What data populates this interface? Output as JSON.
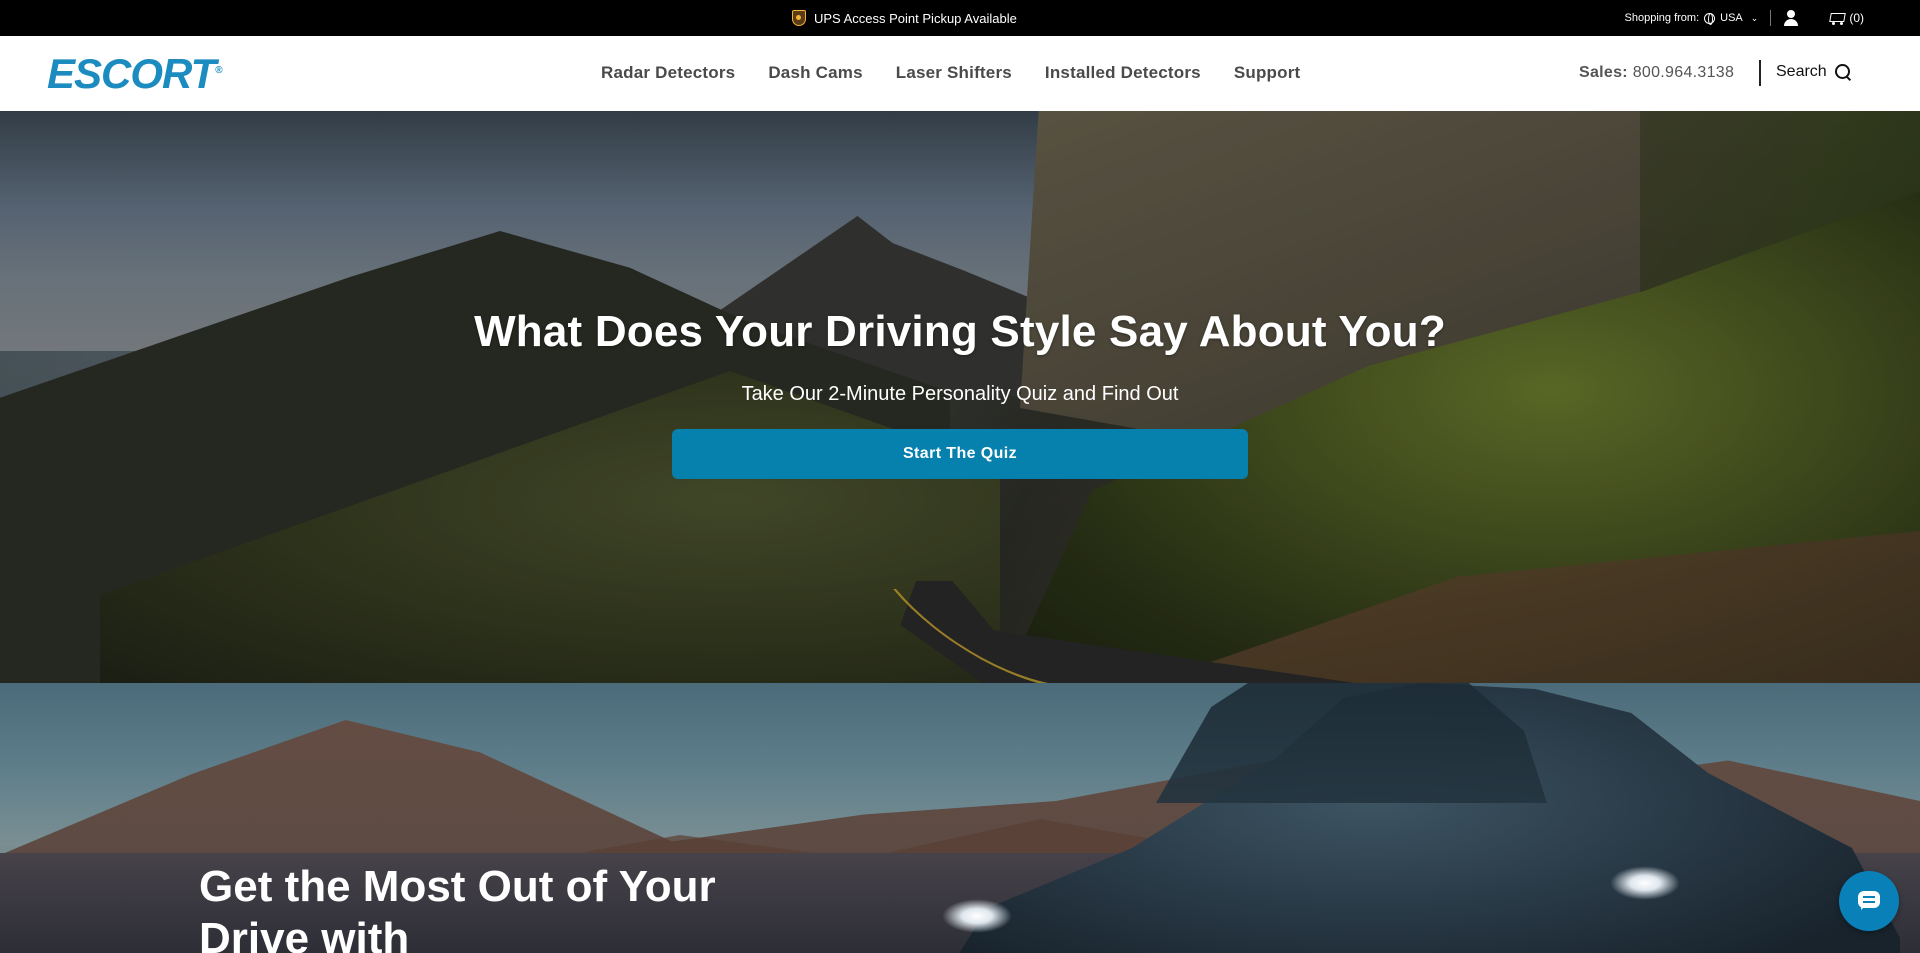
{
  "topbar": {
    "ups_text": "UPS Access Point Pickup Available",
    "shopping_from_label": "Shopping from:",
    "country": "USA",
    "cart_count": "(0)"
  },
  "header": {
    "logo_text": "ESCORT",
    "logo_mark": "®",
    "nav": [
      {
        "label": "Radar Detectors"
      },
      {
        "label": "Dash Cams"
      },
      {
        "label": "Laser Shifters"
      },
      {
        "label": "Installed Detectors"
      },
      {
        "label": "Support"
      }
    ],
    "sales_label": "Sales:",
    "sales_phone": "800.964.3138",
    "search_label": "Search"
  },
  "hero1": {
    "title": "What Does Your Driving Style Say About You?",
    "subtitle": "Take Our 2-Minute Personality Quiz and Find Out",
    "cta_label": "Start The Quiz"
  },
  "hero2": {
    "title": "Get the Most Out of Your Drive with"
  },
  "colors": {
    "brand_blue": "#1c8cc0",
    "cta_blue": "#0681ae",
    "topbar_bg": "#000000",
    "header_bg": "#ffffff"
  },
  "icons": [
    "ups-icon",
    "globe-icon",
    "chevron-down-icon",
    "user-icon",
    "cart-icon",
    "search-icon",
    "chat-icon"
  ]
}
